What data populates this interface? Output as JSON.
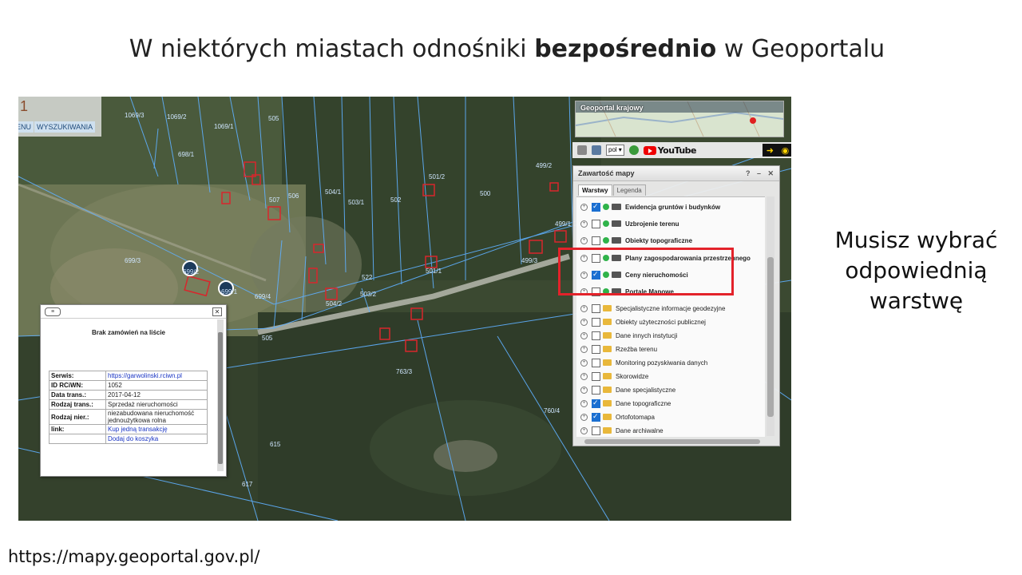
{
  "slide": {
    "title_pre": "W niektórych miastach odnośniki ",
    "title_bold": "bezpośrednio",
    "title_post": " w Geoportalu",
    "side_note": "Musisz wybrać odpowiednią warstwę",
    "footer_url": "https://mapy.geoportal.gov.pl/"
  },
  "map": {
    "top_left_digit": "1",
    "tabs": [
      "ENU",
      "WYSZUKIWANIA"
    ],
    "parcel_labels": [
      "1069/3",
      "1069/2",
      "1069/1",
      "698/1",
      "505",
      "507",
      "506",
      "504/1",
      "503/1",
      "502",
      "500",
      "501/2",
      "499/2",
      "699/3",
      "699/2",
      "699/1",
      "699/4",
      "522",
      "503/2",
      "504/2",
      "501/1",
      "499/3",
      "763/3",
      "505",
      "760/4",
      "615",
      "617",
      "499/1"
    ],
    "mini_map_title": "Geoportal krajowy",
    "toolbar": {
      "language": "pol",
      "youtube_label": "YouTube"
    }
  },
  "layers_panel": {
    "title": "Zawartość mapy",
    "header_icons": "? – ✕",
    "tabs": [
      "Warstwy",
      "Legenda"
    ],
    "items": [
      {
        "label": "Ewidencja gruntów i budynków",
        "checked": true,
        "type": "service",
        "bold": true
      },
      {
        "label": "Uzbrojenie terenu",
        "checked": false,
        "type": "service",
        "bold": true
      },
      {
        "label": "Obiekty topograficzne",
        "checked": false,
        "type": "service",
        "bold": true
      },
      {
        "label": "Plany zagospodarowania przestrzennego",
        "checked": false,
        "type": "service",
        "bold": true
      },
      {
        "label": "Ceny nieruchomości",
        "checked": true,
        "type": "service",
        "bold": true
      },
      {
        "label": "Portale Mapowe",
        "checked": false,
        "type": "service",
        "bold": true
      },
      {
        "label": "Specjalistyczne informacje geodezyjne",
        "checked": false,
        "type": "folder",
        "bold": false
      },
      {
        "label": "Obiekty użyteczności publicznej",
        "checked": false,
        "type": "folder",
        "bold": false
      },
      {
        "label": "Dane innych instytucji",
        "checked": false,
        "type": "folder",
        "bold": false
      },
      {
        "label": "Rzeźba terenu",
        "checked": false,
        "type": "folder",
        "bold": false
      },
      {
        "label": "Monitoring pozyskiwania danych",
        "checked": false,
        "type": "folder",
        "bold": false
      },
      {
        "label": "Skorowidze",
        "checked": false,
        "type": "folder",
        "bold": false
      },
      {
        "label": "Dane specjalistyczne",
        "checked": false,
        "type": "folder",
        "bold": false
      },
      {
        "label": "Dane topograficzne",
        "checked": true,
        "type": "folder",
        "bold": false
      },
      {
        "label": "Ortofotomapa",
        "checked": true,
        "type": "folder",
        "bold": false
      },
      {
        "label": "Dane archiwalne",
        "checked": false,
        "type": "folder",
        "bold": false
      }
    ]
  },
  "popup": {
    "message": "Brak zamówień na liście",
    "rows": [
      {
        "key": "Serwis:",
        "value": "https://garwolinski.rciwn.pl",
        "link": true
      },
      {
        "key": "ID RCiWN:",
        "value": "1052",
        "link": false
      },
      {
        "key": "Data trans.:",
        "value": "2017-04-12",
        "link": false
      },
      {
        "key": "Rodzaj trans.:",
        "value": "Sprzedaż nieruchomości",
        "link": false
      },
      {
        "key": "Rodzaj nier.:",
        "value": "niezabudowana nieruchomość jednoużytkowa rolna",
        "link": false
      },
      {
        "key": "link:",
        "value": "Kup jedną transakcję",
        "link": true
      },
      {
        "key": "",
        "value": "Dodaj do koszyka",
        "link": true
      }
    ]
  },
  "colors": {
    "highlight": "#e3222a",
    "parcel_line": "#5fb0ff",
    "building": "#d8262c"
  }
}
